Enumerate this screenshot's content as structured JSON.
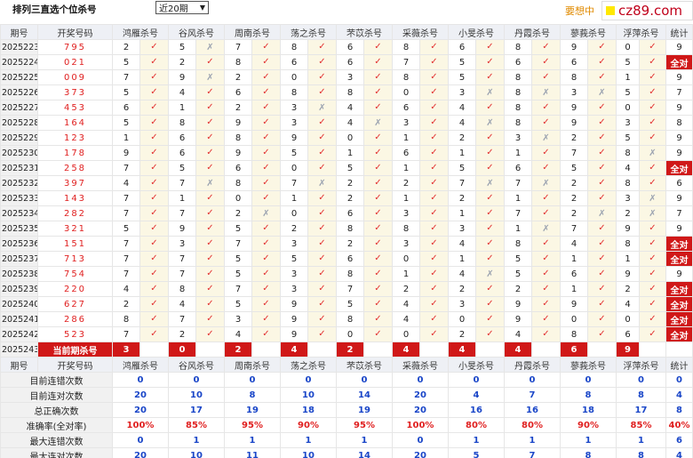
{
  "header": {
    "title": "排列三直选个位杀号",
    "period_select": "近20期",
    "promo": "要想中",
    "logo": "cz89.com"
  },
  "columns": [
    "期号",
    "开奖号码",
    "鸿雁杀号",
    "谷风杀号",
    "周南杀号",
    "荡之杀号",
    "芣苡杀号",
    "采薇杀号",
    "小旻杀号",
    "丹霞杀号",
    "蓼莪杀号",
    "浮萍杀号",
    "统计"
  ],
  "rows": [
    {
      "period": "2025223",
      "draw": "795",
      "k": [
        [
          "2",
          "ok"
        ],
        [
          "5",
          "bad"
        ],
        [
          "7",
          "ok"
        ],
        [
          "8",
          "ok"
        ],
        [
          "6",
          "ok"
        ],
        [
          "8",
          "ok"
        ],
        [
          "6",
          "ok"
        ],
        [
          "8",
          "ok"
        ],
        [
          "9",
          "ok"
        ],
        [
          "0",
          "ok"
        ]
      ],
      "stat": "9"
    },
    {
      "period": "2025224",
      "draw": "021",
      "k": [
        [
          "5",
          "ok"
        ],
        [
          "2",
          "ok"
        ],
        [
          "8",
          "ok"
        ],
        [
          "6",
          "ok"
        ],
        [
          "6",
          "ok"
        ],
        [
          "7",
          "ok"
        ],
        [
          "5",
          "ok"
        ],
        [
          "6",
          "ok"
        ],
        [
          "6",
          "ok"
        ],
        [
          "5",
          "ok"
        ]
      ],
      "stat": "全对"
    },
    {
      "period": "2025225",
      "draw": "009",
      "k": [
        [
          "7",
          "ok"
        ],
        [
          "9",
          "bad"
        ],
        [
          "2",
          "ok"
        ],
        [
          "0",
          "ok"
        ],
        [
          "3",
          "ok"
        ],
        [
          "8",
          "ok"
        ],
        [
          "5",
          "ok"
        ],
        [
          "8",
          "ok"
        ],
        [
          "8",
          "ok"
        ],
        [
          "1",
          "ok"
        ]
      ],
      "stat": "9"
    },
    {
      "period": "2025226",
      "draw": "373",
      "k": [
        [
          "5",
          "ok"
        ],
        [
          "4",
          "ok"
        ],
        [
          "6",
          "ok"
        ],
        [
          "8",
          "ok"
        ],
        [
          "8",
          "ok"
        ],
        [
          "0",
          "ok"
        ],
        [
          "3",
          "bad"
        ],
        [
          "8",
          "bad"
        ],
        [
          "3",
          "bad"
        ],
        [
          "5",
          "ok"
        ]
      ],
      "stat": "7"
    },
    {
      "period": "2025227",
      "draw": "453",
      "k": [
        [
          "6",
          "ok"
        ],
        [
          "1",
          "ok"
        ],
        [
          "2",
          "ok"
        ],
        [
          "3",
          "bad"
        ],
        [
          "4",
          "ok"
        ],
        [
          "6",
          "ok"
        ],
        [
          "4",
          "ok"
        ],
        [
          "8",
          "ok"
        ],
        [
          "9",
          "ok"
        ],
        [
          "0",
          "ok"
        ]
      ],
      "stat": "9"
    },
    {
      "period": "2025228",
      "draw": "164",
      "k": [
        [
          "5",
          "ok"
        ],
        [
          "8",
          "ok"
        ],
        [
          "9",
          "ok"
        ],
        [
          "3",
          "ok"
        ],
        [
          "4",
          "bad"
        ],
        [
          "3",
          "ok"
        ],
        [
          "4",
          "bad"
        ],
        [
          "8",
          "ok"
        ],
        [
          "9",
          "ok"
        ],
        [
          "3",
          "ok"
        ]
      ],
      "stat": "8"
    },
    {
      "period": "2025229",
      "draw": "123",
      "k": [
        [
          "1",
          "ok"
        ],
        [
          "6",
          "ok"
        ],
        [
          "8",
          "ok"
        ],
        [
          "9",
          "ok"
        ],
        [
          "0",
          "ok"
        ],
        [
          "1",
          "ok"
        ],
        [
          "2",
          "ok"
        ],
        [
          "3",
          "bad"
        ],
        [
          "2",
          "ok"
        ],
        [
          "5",
          "ok"
        ]
      ],
      "stat": "9"
    },
    {
      "period": "2025230",
      "draw": "178",
      "k": [
        [
          "9",
          "ok"
        ],
        [
          "6",
          "ok"
        ],
        [
          "9",
          "ok"
        ],
        [
          "5",
          "ok"
        ],
        [
          "1",
          "ok"
        ],
        [
          "6",
          "ok"
        ],
        [
          "1",
          "ok"
        ],
        [
          "1",
          "ok"
        ],
        [
          "7",
          "ok"
        ],
        [
          "8",
          "bad"
        ]
      ],
      "stat": "9"
    },
    {
      "period": "2025231",
      "draw": "258",
      "k": [
        [
          "7",
          "ok"
        ],
        [
          "5",
          "ok"
        ],
        [
          "6",
          "ok"
        ],
        [
          "0",
          "ok"
        ],
        [
          "5",
          "ok"
        ],
        [
          "1",
          "ok"
        ],
        [
          "5",
          "ok"
        ],
        [
          "6",
          "ok"
        ],
        [
          "5",
          "ok"
        ],
        [
          "4",
          "ok"
        ]
      ],
      "stat": "全对"
    },
    {
      "period": "2025232",
      "draw": "397",
      "k": [
        [
          "4",
          "ok"
        ],
        [
          "7",
          "bad"
        ],
        [
          "8",
          "ok"
        ],
        [
          "7",
          "bad"
        ],
        [
          "2",
          "ok"
        ],
        [
          "2",
          "ok"
        ],
        [
          "7",
          "bad"
        ],
        [
          "7",
          "bad"
        ],
        [
          "2",
          "ok"
        ],
        [
          "8",
          "ok"
        ]
      ],
      "stat": "6"
    },
    {
      "period": "2025233",
      "draw": "143",
      "k": [
        [
          "7",
          "ok"
        ],
        [
          "1",
          "ok"
        ],
        [
          "0",
          "ok"
        ],
        [
          "1",
          "ok"
        ],
        [
          "2",
          "ok"
        ],
        [
          "1",
          "ok"
        ],
        [
          "2",
          "ok"
        ],
        [
          "1",
          "ok"
        ],
        [
          "2",
          "ok"
        ],
        [
          "3",
          "bad"
        ]
      ],
      "stat": "9"
    },
    {
      "period": "2025234",
      "draw": "282",
      "k": [
        [
          "7",
          "ok"
        ],
        [
          "7",
          "ok"
        ],
        [
          "2",
          "bad"
        ],
        [
          "0",
          "ok"
        ],
        [
          "6",
          "ok"
        ],
        [
          "3",
          "ok"
        ],
        [
          "1",
          "ok"
        ],
        [
          "7",
          "ok"
        ],
        [
          "2",
          "bad"
        ],
        [
          "2",
          "bad"
        ]
      ],
      "stat": "7"
    },
    {
      "period": "2025235",
      "draw": "321",
      "k": [
        [
          "5",
          "ok"
        ],
        [
          "9",
          "ok"
        ],
        [
          "5",
          "ok"
        ],
        [
          "2",
          "ok"
        ],
        [
          "8",
          "ok"
        ],
        [
          "8",
          "ok"
        ],
        [
          "3",
          "ok"
        ],
        [
          "1",
          "bad"
        ],
        [
          "7",
          "ok"
        ],
        [
          "9",
          "ok"
        ]
      ],
      "stat": "9"
    },
    {
      "period": "2025236",
      "draw": "151",
      "k": [
        [
          "7",
          "ok"
        ],
        [
          "3",
          "ok"
        ],
        [
          "7",
          "ok"
        ],
        [
          "3",
          "ok"
        ],
        [
          "2",
          "ok"
        ],
        [
          "3",
          "ok"
        ],
        [
          "4",
          "ok"
        ],
        [
          "8",
          "ok"
        ],
        [
          "4",
          "ok"
        ],
        [
          "8",
          "ok"
        ]
      ],
      "stat": "全对"
    },
    {
      "period": "2025237",
      "draw": "713",
      "k": [
        [
          "7",
          "ok"
        ],
        [
          "7",
          "ok"
        ],
        [
          "5",
          "ok"
        ],
        [
          "5",
          "ok"
        ],
        [
          "6",
          "ok"
        ],
        [
          "0",
          "ok"
        ],
        [
          "1",
          "ok"
        ],
        [
          "5",
          "ok"
        ],
        [
          "1",
          "ok"
        ],
        [
          "1",
          "ok"
        ]
      ],
      "stat": "全对"
    },
    {
      "period": "2025238",
      "draw": "754",
      "k": [
        [
          "7",
          "ok"
        ],
        [
          "7",
          "ok"
        ],
        [
          "5",
          "ok"
        ],
        [
          "3",
          "ok"
        ],
        [
          "8",
          "ok"
        ],
        [
          "1",
          "ok"
        ],
        [
          "4",
          "bad"
        ],
        [
          "5",
          "ok"
        ],
        [
          "6",
          "ok"
        ],
        [
          "9",
          "ok"
        ]
      ],
      "stat": "9"
    },
    {
      "period": "2025239",
      "draw": "220",
      "k": [
        [
          "4",
          "ok"
        ],
        [
          "8",
          "ok"
        ],
        [
          "7",
          "ok"
        ],
        [
          "3",
          "ok"
        ],
        [
          "7",
          "ok"
        ],
        [
          "2",
          "ok"
        ],
        [
          "2",
          "ok"
        ],
        [
          "2",
          "ok"
        ],
        [
          "1",
          "ok"
        ],
        [
          "2",
          "ok"
        ]
      ],
      "stat": "全对"
    },
    {
      "period": "2025240",
      "draw": "627",
      "k": [
        [
          "2",
          "ok"
        ],
        [
          "4",
          "ok"
        ],
        [
          "5",
          "ok"
        ],
        [
          "9",
          "ok"
        ],
        [
          "5",
          "ok"
        ],
        [
          "4",
          "ok"
        ],
        [
          "3",
          "ok"
        ],
        [
          "9",
          "ok"
        ],
        [
          "9",
          "ok"
        ],
        [
          "4",
          "ok"
        ]
      ],
      "stat": "全对"
    },
    {
      "period": "2025241",
      "draw": "286",
      "k": [
        [
          "8",
          "ok"
        ],
        [
          "7",
          "ok"
        ],
        [
          "3",
          "ok"
        ],
        [
          "9",
          "ok"
        ],
        [
          "8",
          "ok"
        ],
        [
          "4",
          "ok"
        ],
        [
          "0",
          "ok"
        ],
        [
          "9",
          "ok"
        ],
        [
          "0",
          "ok"
        ],
        [
          "0",
          "ok"
        ]
      ],
      "stat": "全对"
    },
    {
      "period": "2025242",
      "draw": "523",
      "k": [
        [
          "7",
          "ok"
        ],
        [
          "2",
          "ok"
        ],
        [
          "4",
          "ok"
        ],
        [
          "9",
          "ok"
        ],
        [
          "0",
          "ok"
        ],
        [
          "0",
          "ok"
        ],
        [
          "2",
          "ok"
        ],
        [
          "4",
          "ok"
        ],
        [
          "8",
          "ok"
        ],
        [
          "6",
          "ok"
        ]
      ],
      "stat": "全对"
    }
  ],
  "current": {
    "period": "2025243",
    "label": "当前期杀号",
    "kills": [
      "3",
      "0",
      "2",
      "4",
      "2",
      "4",
      "4",
      "4",
      "6",
      "9"
    ]
  },
  "stats": [
    {
      "label": "目前连错次数",
      "vals": [
        "0",
        "0",
        "0",
        "0",
        "0",
        "0",
        "0",
        "0",
        "0",
        "0"
      ],
      "total": "0",
      "cls": "blue"
    },
    {
      "label": "目前连对次数",
      "vals": [
        "20",
        "10",
        "8",
        "10",
        "14",
        "20",
        "4",
        "7",
        "8",
        "8"
      ],
      "total": "4",
      "cls": "blue"
    },
    {
      "label": "总正确次数",
      "vals": [
        "20",
        "17",
        "19",
        "18",
        "19",
        "20",
        "16",
        "16",
        "18",
        "17"
      ],
      "total": "8",
      "cls": "blue"
    },
    {
      "label": "准确率(全对率)",
      "vals": [
        "100%",
        "85%",
        "95%",
        "90%",
        "95%",
        "100%",
        "80%",
        "80%",
        "90%",
        "85%"
      ],
      "total": "40%",
      "cls": "red"
    },
    {
      "label": "最大连错次数",
      "vals": [
        "0",
        "1",
        "1",
        "1",
        "1",
        "0",
        "1",
        "1",
        "1",
        "1"
      ],
      "total": "6",
      "cls": "blue"
    },
    {
      "label": "最大连对次数",
      "vals": [
        "20",
        "10",
        "11",
        "10",
        "14",
        "20",
        "5",
        "7",
        "8",
        "8"
      ],
      "total": "4",
      "cls": "blue"
    }
  ],
  "marks": {
    "ok": "✓",
    "bad": "✗"
  },
  "colors": {
    "accent_red": "#d01818",
    "check_red": "#e23030",
    "stat_blue": "#1a46c8",
    "promo_orange": "#e08a00"
  }
}
